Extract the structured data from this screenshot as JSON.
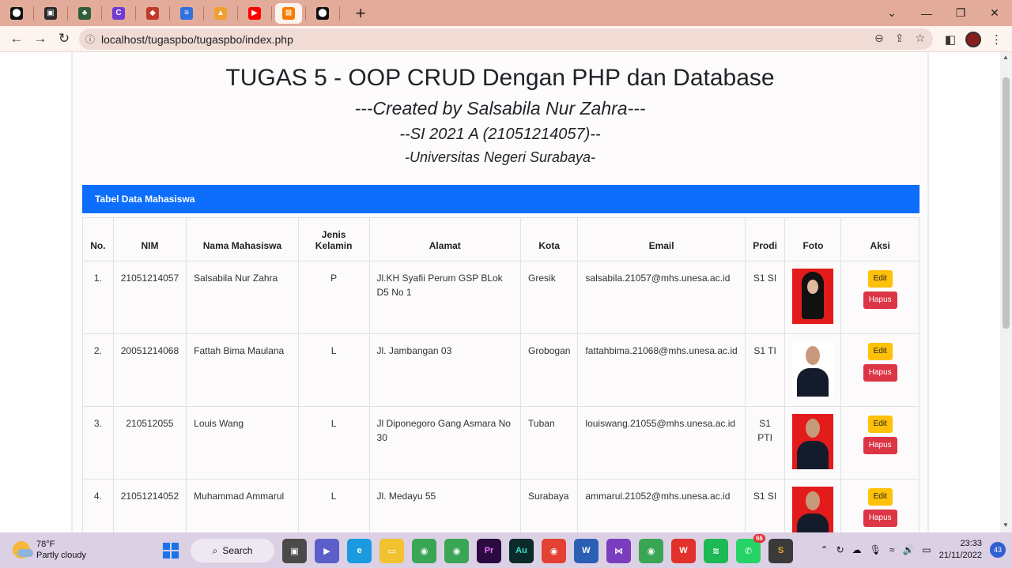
{
  "browser": {
    "tabs": [
      {
        "icon": "github-icon",
        "color": "#111111",
        "glyph": "⬤"
      },
      {
        "icon": "app-icon",
        "color": "#2b2b2b",
        "glyph": "▣"
      },
      {
        "icon": "leaf-icon",
        "color": "#2e5e3a",
        "glyph": "♣"
      },
      {
        "icon": "canva-icon",
        "color": "#6f3ad6",
        "glyph": "C"
      },
      {
        "icon": "cube-icon",
        "color": "#c0392b",
        "glyph": "◆"
      },
      {
        "icon": "docs-icon",
        "color": "#2f6fdf",
        "glyph": "≡"
      },
      {
        "icon": "pma-icon",
        "color": "#f0a030",
        "glyph": "▲"
      },
      {
        "icon": "youtube-icon",
        "color": "#ff0000",
        "glyph": "▶"
      },
      {
        "icon": "xampp-icon",
        "color": "#f57c00",
        "glyph": "⊠",
        "active": true
      },
      {
        "icon": "github-icon",
        "color": "#111111",
        "glyph": "⬤"
      }
    ],
    "new_tab": "+",
    "url": "localhost/tugaspbo/tugaspbo/index.php"
  },
  "page": {
    "title": "TUGAS 5 - OOP CRUD Dengan PHP dan Database",
    "created_by": "---Created by Salsabila Nur Zahra---",
    "class_id": "--SI 2021 A (21051214057)--",
    "university": "-Universitas Negeri Surabaya-",
    "table_title": "Tabel Data Mahasiswa",
    "columns": [
      "No.",
      "NIM",
      "Nama Mahasiswa",
      "Jenis Kelamin",
      "Alamat",
      "Kota",
      "Email",
      "Prodi",
      "Foto",
      "Aksi"
    ],
    "edit_label": "Edit",
    "delete_label": "Hapus",
    "rows": [
      {
        "no": "1.",
        "nim": "21051214057",
        "nama": "Salsabila Nur Zahra",
        "jk": "P",
        "alamat": "Jl.KH Syafii Perum GSP BLok D5 No 1",
        "kota": "Gresik",
        "email": "salsabila.21057@mhs.unesa.ac.id",
        "prodi": "S1 SI",
        "photo_bg": "#e31b1b",
        "hijab": true
      },
      {
        "no": "2.",
        "nim": "20051214068",
        "nama": "Fattah Bima Maulana",
        "jk": "L",
        "alamat": "Jl. Jambangan 03",
        "kota": "Grobogan",
        "email": "fattahbima.21068@mhs.unesa.ac.id",
        "prodi": "S1 TI",
        "photo_bg": "#ffffff",
        "hijab": false
      },
      {
        "no": "3.",
        "nim": "210512055",
        "nama": "Louis Wang",
        "jk": "L",
        "alamat": "Jl Diponegoro Gang Asmara No 30",
        "kota": "Tuban",
        "email": "louiswang.21055@mhs.unesa.ac.id",
        "prodi": "S1 PTI",
        "photo_bg": "#e31b1b",
        "hijab": false
      },
      {
        "no": "4.",
        "nim": "21051214052",
        "nama": "Muhammad Ammarul",
        "jk": "L",
        "alamat": "Jl. Medayu 55",
        "kota": "Surabaya",
        "email": "ammarul.21052@mhs.unesa.ac.id",
        "prodi": "S1 SI",
        "photo_bg": "#e31b1b",
        "hijab": false
      }
    ]
  },
  "taskbar": {
    "temp": "78°F",
    "weather": "Partly cloudy",
    "search_label": "Search",
    "time": "23:33",
    "date": "21/11/2022",
    "notifications": "43",
    "whatsapp_badge": "66"
  }
}
